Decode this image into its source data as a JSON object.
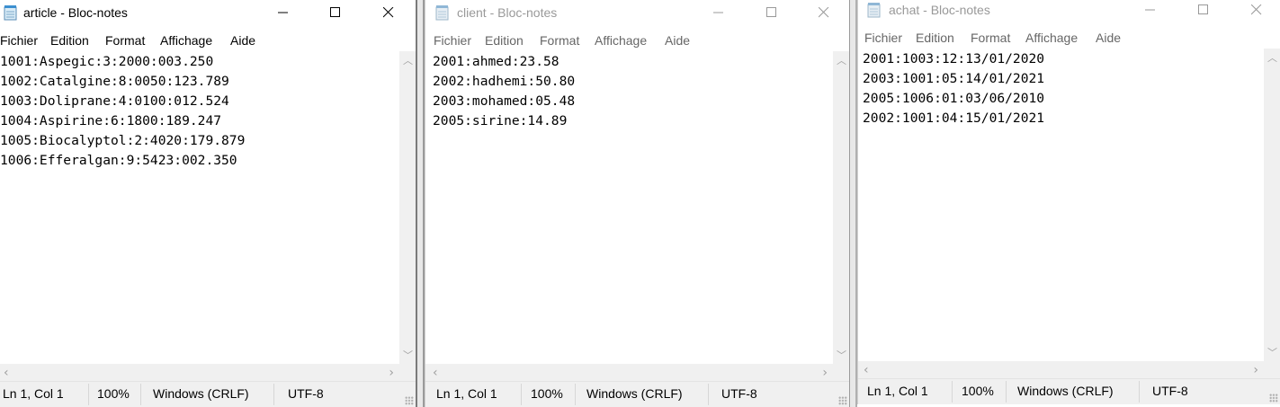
{
  "windows": [
    {
      "title": "article - Bloc-notes",
      "menu": [
        "Fichier",
        "Edition",
        "Format",
        "Affichage",
        "Aide"
      ],
      "lines": [
        "1001:Aspegic:3:2000:003.250",
        "1002:Catalgine:8:0050:123.789",
        "1003:Doliprane:4:0100:012.524",
        "1004:Aspirine:6:1800:189.247",
        "1005:Biocalyptol:2:4020:179.879",
        "1006:Efferalgan:9:5423:002.350"
      ],
      "status": {
        "position": "Ln 1, Col 1",
        "zoom": "100%",
        "eol": "Windows (CRLF)",
        "encoding": "UTF-8"
      }
    },
    {
      "title": "client - Bloc-notes",
      "menu": [
        "Fichier",
        "Edition",
        "Format",
        "Affichage",
        "Aide"
      ],
      "lines": [
        "2001:ahmed:23.58",
        "2002:hadhemi:50.80",
        "2003:mohamed:05.48",
        "2005:sirine:14.89"
      ],
      "status": {
        "position": "Ln 1, Col 1",
        "zoom": "100%",
        "eol": "Windows (CRLF)",
        "encoding": "UTF-8"
      }
    },
    {
      "title": "achat - Bloc-notes",
      "menu": [
        "Fichier",
        "Edition",
        "Format",
        "Affichage",
        "Aide"
      ],
      "lines": [
        "2001:1003:12:13/01/2020",
        "2003:1001:05:14/01/2021",
        "2005:1006:01:03/06/2010",
        "2002:1001:04:15/01/2021"
      ],
      "status": {
        "position": "Ln 1, Col 1",
        "zoom": "100%",
        "eol": "Windows (CRLF)",
        "encoding": "UTF-8"
      }
    }
  ],
  "icons": {
    "app": "notepad-icon",
    "minimize": "minimize-icon",
    "maximize": "maximize-icon",
    "close": "close-icon",
    "scroll_up": "chevron-up-icon",
    "scroll_down": "chevron-down-icon",
    "scroll_left": "chevron-left-icon",
    "scroll_right": "chevron-right-icon"
  }
}
